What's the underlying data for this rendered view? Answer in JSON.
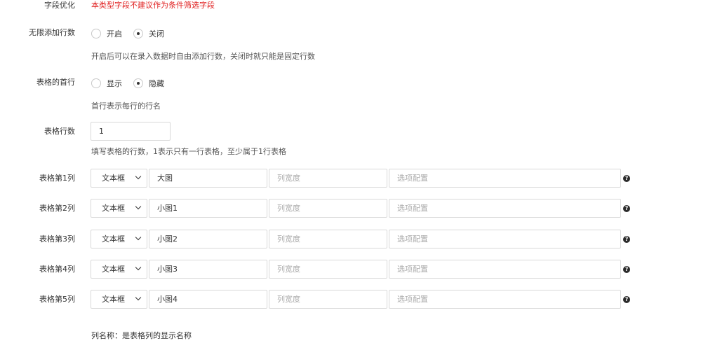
{
  "field_opt": {
    "label": "字段优化",
    "warning": "本类型字段不建议作为条件筛选字段"
  },
  "unlimited": {
    "label": "无限添加行数",
    "options": [
      {
        "text": "开启",
        "checked": false
      },
      {
        "text": "关闭",
        "checked": true
      }
    ],
    "help": "开启后可以在录入数据时自由添加行数，关闭时就只能是固定行数"
  },
  "first_row": {
    "label": "表格的首行",
    "options": [
      {
        "text": "显示",
        "checked": false
      },
      {
        "text": "隐藏",
        "checked": true
      }
    ],
    "help": "首行表示每行的行名"
  },
  "row_count": {
    "label": "表格行数",
    "value": "1",
    "help": "填写表格的行数，1表示只有一行表格，至少属于1行表格"
  },
  "columns": [
    {
      "label": "表格第1列",
      "type": "文本框",
      "name": "大图",
      "width_placeholder": "列宽度",
      "options_placeholder": "选项配置"
    },
    {
      "label": "表格第2列",
      "type": "文本框",
      "name": "小图1",
      "width_placeholder": "列宽度",
      "options_placeholder": "选项配置"
    },
    {
      "label": "表格第3列",
      "type": "文本框",
      "name": "小图2",
      "width_placeholder": "列宽度",
      "options_placeholder": "选项配置"
    },
    {
      "label": "表格第4列",
      "type": "文本框",
      "name": "小图3",
      "width_placeholder": "列宽度",
      "options_placeholder": "选项配置"
    },
    {
      "label": "表格第5列",
      "type": "文本框",
      "name": "小图4",
      "width_placeholder": "列宽度",
      "options_placeholder": "选项配置"
    }
  ],
  "help_icon_glyph": "?",
  "footer_note": "列名称：是表格列的显示名称"
}
